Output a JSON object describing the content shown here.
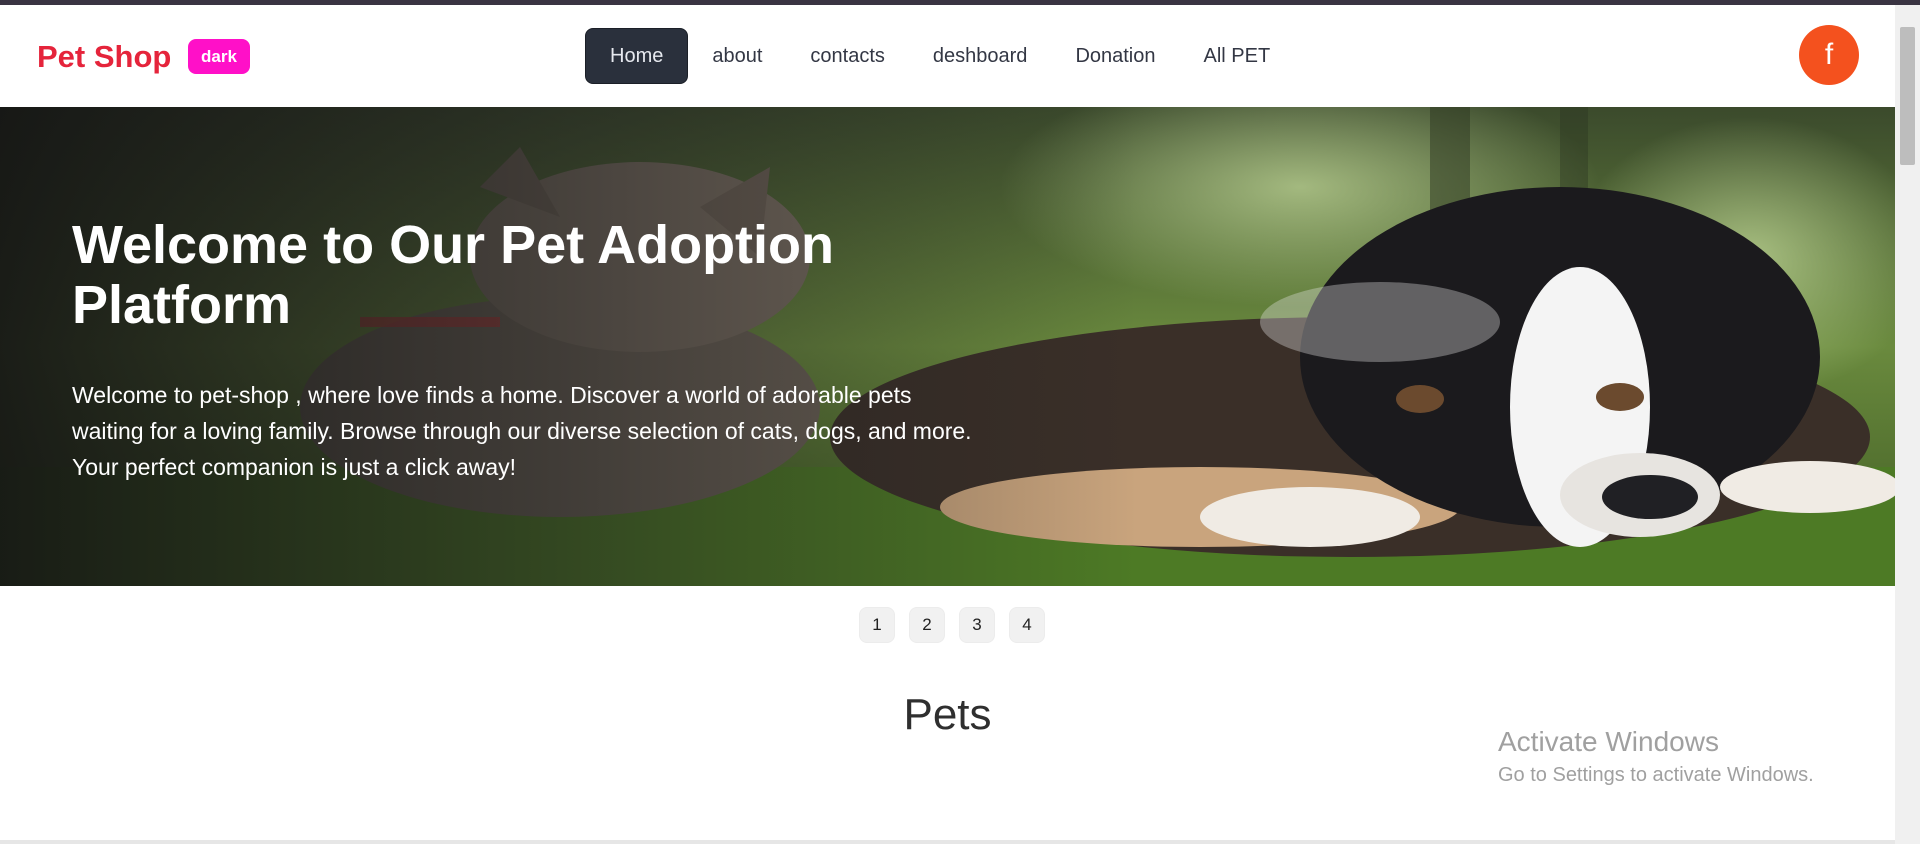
{
  "brand": {
    "name": "Pet Shop",
    "theme_toggle": "dark"
  },
  "nav": {
    "items": [
      {
        "label": "Home",
        "active": true
      },
      {
        "label": "about",
        "active": false
      },
      {
        "label": "contacts",
        "active": false
      },
      {
        "label": "deshboard",
        "active": false
      },
      {
        "label": "Donation",
        "active": false
      },
      {
        "label": "All PET",
        "active": false
      }
    ],
    "social_button": "f"
  },
  "hero": {
    "title": "Welcome to Our Pet Adoption Platform",
    "text": "Welcome to pet-shop , where love finds a home. Discover a world of adorable pets waiting for a loving family. Browse through our diverse selection of cats, dogs, and more. Your perfect companion is just a click away!"
  },
  "carousel": {
    "slides": [
      "1",
      "2",
      "3",
      "4"
    ]
  },
  "section": {
    "title": "Pets"
  },
  "watermark": {
    "title": "Activate Windows",
    "subtitle": "Go to Settings to activate Windows."
  },
  "colors": {
    "brand": "#e5243b",
    "badge": "#ff10c8",
    "nav_active": "#2a303c",
    "facebook": "#f4511e"
  },
  "icons": {
    "social": "facebook-icon"
  }
}
